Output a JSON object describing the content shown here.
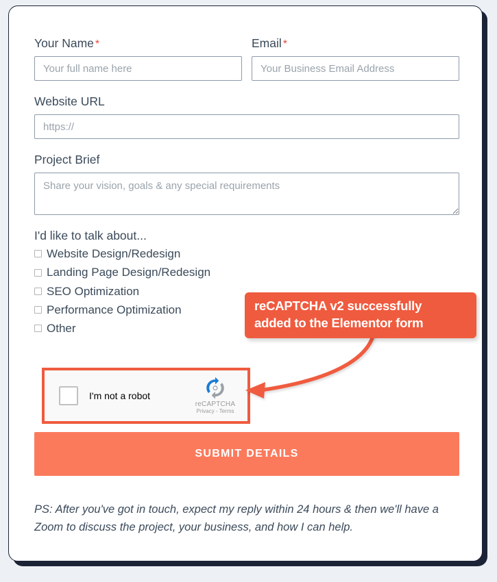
{
  "card": {
    "accent_color": "#fb7a5c",
    "annotation_color": "#ef5b3f",
    "border_color": "#1a2236",
    "page_background": "#edf1f5"
  },
  "form": {
    "fields": [
      {
        "id": "your-name",
        "label": "Your Name",
        "required": true,
        "required_mark": "*",
        "placeholder": "Your full name here",
        "value": ""
      },
      {
        "id": "email",
        "label": "Email",
        "required": true,
        "required_mark": "*",
        "placeholder": "Your Business Email Address",
        "value": ""
      },
      {
        "id": "website-url",
        "label": "Website URL",
        "required": false,
        "placeholder": "https://",
        "value": ""
      },
      {
        "id": "project-brief",
        "label": "Project Brief",
        "required": false,
        "placeholder": "Share your vision, goals & any special requirements",
        "value": ""
      }
    ],
    "checkbox_group": {
      "title": "I'd like to talk about...",
      "options": [
        {
          "label": "Website Design/Redesign",
          "checked": false
        },
        {
          "label": "Landing Page Design/Redesign",
          "checked": false
        },
        {
          "label": "SEO Optimization",
          "checked": false
        },
        {
          "label": "Performance Optimization",
          "checked": false
        },
        {
          "label": "Other",
          "checked": false
        }
      ]
    },
    "recaptcha": {
      "checkbox_label": "I'm not a robot",
      "checked": false,
      "brand": "reCAPTCHA",
      "legal": "Privacy - Terms",
      "logo_icon": "recaptcha-logo-icon",
      "highlight_color": "#ef5b3f"
    },
    "submit": {
      "label": "SUBMIT DETAILS"
    },
    "ps_note": "PS: After you've got in touch, expect my reply within 24 hours & then we'll have a Zoom to discuss the project, your business, and how I can help."
  },
  "annotation": {
    "line1": "reCAPTCHA v2 successfully",
    "line2": "added to the Elementor form",
    "arrow_icon": "curved-arrow-icon"
  }
}
